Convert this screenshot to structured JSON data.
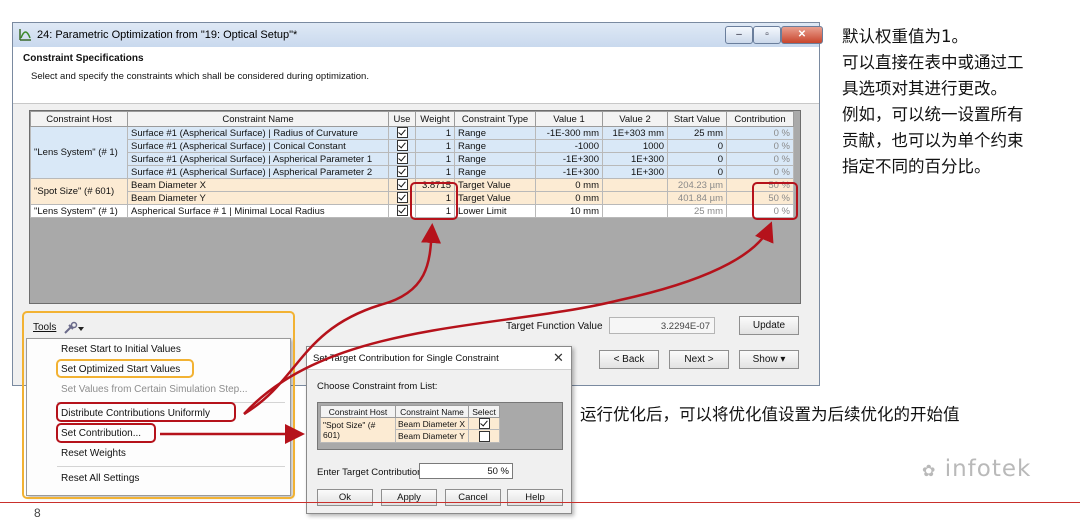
{
  "window": {
    "title": "24: Parametric Optimization from \"19: Optical Setup\"*",
    "controls": [
      "–",
      "▫",
      "✕"
    ]
  },
  "spec": {
    "title": "Constraint Specifications",
    "description": "Select and specify the constraints which shall be considered during optimization."
  },
  "table": {
    "headers": [
      "Constraint Host",
      "Constraint Name",
      "Use",
      "Weight",
      "Constraint Type",
      "Value 1",
      "Value 2",
      "Start Value",
      "Contribution"
    ],
    "hosts": [
      "\"Lens System\" (# 1)",
      "\"Spot Size\" (# 601)",
      "\"Lens System\" (# 1)"
    ],
    "rows": [
      {
        "name": "Surface #1 (Aspherical Surface) | Radius of Curvature",
        "use": true,
        "weight": "1",
        "type": "Range",
        "v1": "-1E-300 mm",
        "v2": "1E+303 mm",
        "start": "25 mm",
        "contribution": "0 %"
      },
      {
        "name": "Surface #1 (Aspherical Surface) | Conical Constant",
        "use": true,
        "weight": "1",
        "type": "Range",
        "v1": "-1000",
        "v2": "1000",
        "start": "0",
        "contribution": "0 %"
      },
      {
        "name": "Surface #1 (Aspherical Surface) | Aspherical Parameter 1",
        "use": true,
        "weight": "1",
        "type": "Range",
        "v1": "-1E+300",
        "v2": "1E+300",
        "start": "0",
        "contribution": "0 %"
      },
      {
        "name": "Surface #1 (Aspherical Surface) | Aspherical Parameter 2",
        "use": true,
        "weight": "1",
        "type": "Range",
        "v1": "-1E+300",
        "v2": "1E+300",
        "start": "0",
        "contribution": "0 %"
      },
      {
        "name": "Beam Diameter X",
        "use": true,
        "weight": "3.8715",
        "type": "Target Value",
        "v1": "0 mm",
        "v2": "",
        "start": "204.23 µm",
        "contribution": "50 %"
      },
      {
        "name": "Beam Diameter Y",
        "use": true,
        "weight": "1",
        "type": "Target Value",
        "v1": "0 mm",
        "v2": "",
        "start": "401.84 µm",
        "contribution": "50 %"
      },
      {
        "name": "Aspherical Surface # 1 | Minimal Local Radius",
        "use": true,
        "weight": "1",
        "type": "Lower Limit",
        "v1": "10 mm",
        "v2": "",
        "start": "25 mm",
        "contribution": "0 %"
      }
    ]
  },
  "bottom": {
    "tools_label": "Tools",
    "tfv_label": "Target Function Value",
    "tfv_value": "3.2294E-07",
    "update": "Update",
    "back": "< Back",
    "next": "Next >",
    "show": "Show ▾"
  },
  "menu": {
    "items": [
      "Reset Start to Initial Values",
      "Set Optimized Start Values",
      "Set Values from Certain Simulation Step...",
      "Distribute Contributions Uniformly",
      "Set Contribution...",
      "Reset Weights",
      "Reset All Settings"
    ]
  },
  "dialog": {
    "title": "Set Target Contribution for Single Constraint",
    "choose": "Choose Constraint from List:",
    "headers": [
      "Constraint Host",
      "Constraint Name",
      "Select"
    ],
    "host": "\"Spot Size\" (# 601)",
    "rows": [
      {
        "name": "Beam Diameter X",
        "selected": true
      },
      {
        "name": "Beam Diameter Y",
        "selected": false
      }
    ],
    "enter_label": "Enter Target Contribution:",
    "enter_value": "50 %",
    "buttons": [
      "Ok",
      "Apply",
      "Cancel",
      "Help"
    ]
  },
  "notes": {
    "right": [
      "默认权重值为1。",
      "可以直接在表中或通过工",
      "具选项对其进行更改。",
      "例如，可以统一设置所有",
      "贡献，也可以为单个约束",
      "指定不同的百分比。"
    ],
    "bottom": "运行优化后，可以将优化值设置为后续优化的开始值"
  },
  "watermark": "infotek",
  "page_number": "8",
  "colors": {
    "highlight_red": "#b5121b",
    "highlight_yellow": "#f2b233",
    "row_blue": "#d9e8f7",
    "row_yellow": "#fcebd3"
  }
}
